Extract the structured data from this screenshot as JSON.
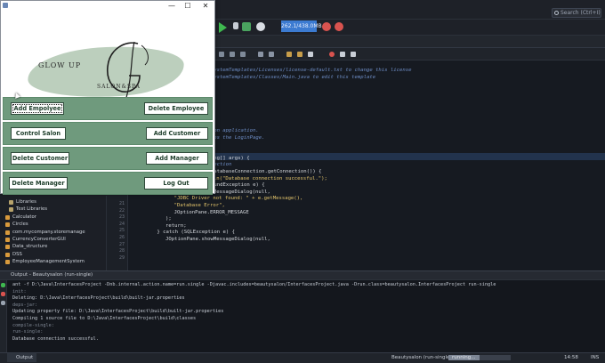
{
  "ide": {
    "search_placeholder": "Search (Ctrl+I)",
    "memory_meter": "262.1/438.0MB",
    "line_numbers": [
      "21",
      "22",
      "23",
      "24",
      "25",
      "26",
      "27",
      "28",
      "29"
    ],
    "code_lines": [
      "/FileSystemTemplates/Licenses/license-default.txt to change this license",
      "/FileSystemTemplates/Classes/Main.java to edit this template",
      "",
      "e;",
      "on;",
      "ane;",
      "on;",
      "",
      "",
      "ty Salon application.",
      "nn opens the LoginPage.",
      "",
      "ject {",
      "n(String[] args) {",
      "e connection",
      "on = DatabaseConnection.getConnection()) {",
      "System.out.println(\"Database connection successful.\");",
      "} catch (ClassNotFoundException e) {",
      "JOptionPane.showMessageDialog(null,",
      "\"JDBC Driver not found: \" + e.getMessage(),",
      "\"Database Error\",",
      "JOptionPane.ERROR_MESSAGE",
      ");",
      "return;",
      "} catch (SQLException e) {",
      "JOptionPane.showMessageDialog(null,"
    ]
  },
  "project_tree": {
    "items": [
      {
        "label": "Libraries",
        "icon": "library-icon"
      },
      {
        "label": "Test Libraries",
        "icon": "library-icon"
      },
      {
        "label": "Calculator",
        "icon": "project-icon"
      },
      {
        "label": "Circles",
        "icon": "project-icon"
      },
      {
        "label": "com.mycompany.storemanage",
        "icon": "project-icon"
      },
      {
        "label": "CurrencyConverterGUI",
        "icon": "project-icon"
      },
      {
        "label": "Data_structure",
        "icon": "project-icon"
      },
      {
        "label": "DSS",
        "icon": "project-icon"
      },
      {
        "label": "EmployeeManagementSystem",
        "icon": "project-icon"
      }
    ]
  },
  "output": {
    "header": "Output - Beautysalon (run-single)",
    "lines": [
      "ant -f D:\\Java\\InterfacesProject -Dnb.internal.action.name=run.single -Djavac.includes=beautysalon/InterfacesProject.java -Drun.class=beautysalon.InterfacesProject run-single",
      "init:",
      "Deleting: D:\\Java\\InterfacesProject\\build\\built-jar.properties",
      "deps-jar:",
      "Updating property file: D:\\Java\\InterfacesProject\\build\\built-jar.properties",
      "Compiling 1 source file to D:\\Java\\InterfacesProject\\build\\classes",
      "compile-single:",
      "run-single:",
      "Database connection successful."
    ]
  },
  "statusbar": {
    "output_tab": "Output",
    "task_name": "Beautysalon (run-single)",
    "task_status": "running...",
    "task_progress": 0.5,
    "cursor_pos": "14:58",
    "insert_mode": "INS"
  },
  "dialog": {
    "window_controls": {
      "minimize": "—",
      "maximize": "☐",
      "close": "✕"
    },
    "logo": {
      "top_text": "GLOW UP",
      "sub_text": "SALON&SPA",
      "blob_color": "#bccfbd"
    },
    "accent_color": "#6f9a7d",
    "buttons": [
      {
        "label": "Add Empolyee"
      },
      {
        "label": "Delete Employee"
      },
      {
        "label": "Control Salon"
      },
      {
        "label": "Add Customer"
      },
      {
        "label": "Delete Customer"
      },
      {
        "label": "Add Manager"
      },
      {
        "label": "Delete Manager"
      },
      {
        "label": "Log Out"
      }
    ]
  }
}
